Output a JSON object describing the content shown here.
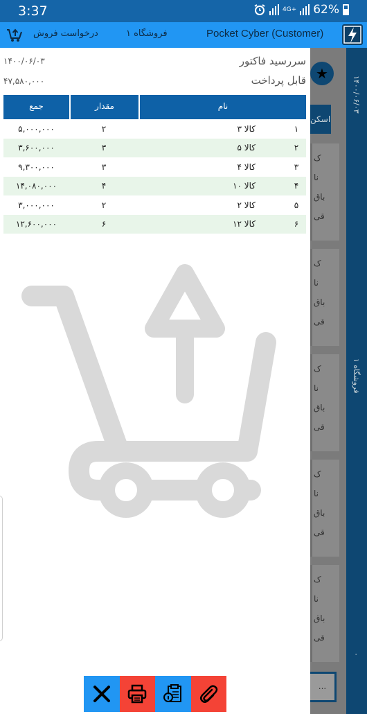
{
  "status_bar": {
    "time": "3:37",
    "network": "4G+",
    "battery": "62%"
  },
  "toolbar": {
    "app_title": "Pocket Cyber (Customer)",
    "store": "فروشگاه ۱",
    "sale_request": "درخواست فروش",
    "cart_icon": "cart-upload-icon",
    "logo_icon": "lightning-logo-icon"
  },
  "background_page": {
    "date": "۱۴۰۰/۰۶/۰۳",
    "store": "فروشگاه ۱",
    "scan_button": "اسکن",
    "card_lines": [
      "ک",
      "نا",
      "باق",
      "قی"
    ],
    "more_button": "...",
    "bottom_number": "۰"
  },
  "invoice": {
    "due_label": "سررسید فاکتور",
    "due_date": "۱۴۰۰/۰۶/۰۳",
    "payable_label": "قابل پرداخت",
    "payable_amount": "۴۷,۵۸۰,۰۰۰",
    "columns": {
      "total": "جمع",
      "quantity": "مقدار",
      "name": "نام"
    },
    "rows": [
      {
        "index": "۱",
        "name": "کالا ۳",
        "quantity": "۲",
        "total": "۵,۰۰۰,۰۰۰"
      },
      {
        "index": "۲",
        "name": "کالا ۵",
        "quantity": "۳",
        "total": "۳,۶۰۰,۰۰۰"
      },
      {
        "index": "۳",
        "name": "کالا ۴",
        "quantity": "۳",
        "total": "۹,۳۰۰,۰۰۰"
      },
      {
        "index": "۴",
        "name": "کالا ۱۰",
        "quantity": "۴",
        "total": "۱۴,۰۸۰,۰۰۰"
      },
      {
        "index": "۵",
        "name": "کالا ۲",
        "quantity": "۲",
        "total": "۳,۰۰۰,۰۰۰"
      },
      {
        "index": "۶",
        "name": "کالا ۱۲",
        "quantity": "۶",
        "total": "۱۲,۶۰۰,۰۰۰"
      }
    ]
  },
  "actions": [
    {
      "name": "close-button",
      "icon": "close-icon"
    },
    {
      "name": "print-button",
      "icon": "printer-icon"
    },
    {
      "name": "info-button",
      "icon": "clipboard-info-icon"
    },
    {
      "name": "attach-button",
      "icon": "paperclip-icon"
    }
  ],
  "colors": {
    "status_bar": "#1565a8",
    "toolbar": "#2196f3",
    "table_header": "#0e61a7",
    "row_alt": "#e8f5e9",
    "action_blue": "#2196f3",
    "action_red": "#f44336"
  }
}
